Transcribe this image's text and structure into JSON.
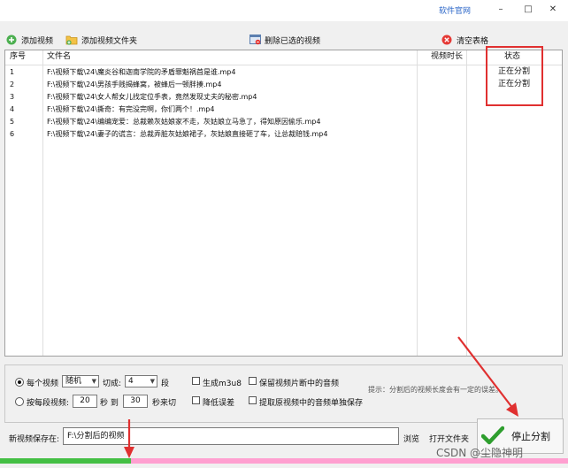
{
  "titlebar": {
    "link_text": "软件官网",
    "min_icon": "–",
    "max_icon": "□",
    "close_icon": "✕"
  },
  "toolbar": {
    "add_video": "添加视频",
    "add_folder": "添加视频文件夹",
    "delete_selected": "删除已选的视频",
    "clear_table": "清空表格"
  },
  "table": {
    "columns": {
      "index": "序号",
      "filename": "文件名",
      "duration": "视频时长",
      "status": "状态"
    },
    "rows": [
      {
        "index": "1",
        "filename": "F:\\视频下载\\24\\魔炎谷和迦南学院的矛盾罪魁祸首是谁.mp4",
        "status": "正在分割"
      },
      {
        "index": "2",
        "filename": "F:\\视频下载\\24\\男孩手贱揭蜂窝，被蜂后一顿胖揍.mp4",
        "status": "正在分割"
      },
      {
        "index": "3",
        "filename": "F:\\视频下载\\24\\女人帮女儿找定位手表，竟然发现丈夫的秘密.mp4",
        "status": ""
      },
      {
        "index": "4",
        "filename": "F:\\视频下载\\24\\撕奇：有完没完啊，你们两个！.mp4",
        "status": ""
      },
      {
        "index": "5",
        "filename": "F:\\视频下载\\24\\编编宠爱：总裁赖灰姑娘家不走，灰姑娘立马急了，得知原因偷乐.mp4",
        "status": ""
      },
      {
        "index": "6",
        "filename": "F:\\视频下载\\24\\妻子的谎言：总裁弄脏灰姑娘裙子，灰姑娘直接砸了车，让总裁赔钱.mp4",
        "status": ""
      }
    ]
  },
  "options": {
    "each_video": "每个视频",
    "random": "随机",
    "cut_into": "切成:",
    "segments_value": "4",
    "segments_unit": "段",
    "generate_m3u8": "生成m3u8",
    "keep_audio": "保留视频片断中的音频",
    "per_segment": "按每段视频:",
    "from_value": "20",
    "seconds_to": "秒 到",
    "to_value": "30",
    "seconds_cut": "秒来切",
    "reduce_error": "降低误差",
    "extract_audio": "提取原视频中的音频单独保存",
    "hint": "提示：分割后的视频长度会有一定的误差。"
  },
  "save": {
    "label": "新视频保存在:",
    "path": "F:\\分割后的视频",
    "browse": "浏览",
    "open_folder": "打开文件夹"
  },
  "stop_button": "停止分割",
  "progress": {
    "fraction": 0.23
  },
  "watermark": "CSDN @尘隐神明",
  "colors": {
    "annotation_red": "#e03030",
    "progress_done": "#44bf44",
    "progress_remaining": "#ff9fd0",
    "link_blue": "#2b66c8"
  }
}
